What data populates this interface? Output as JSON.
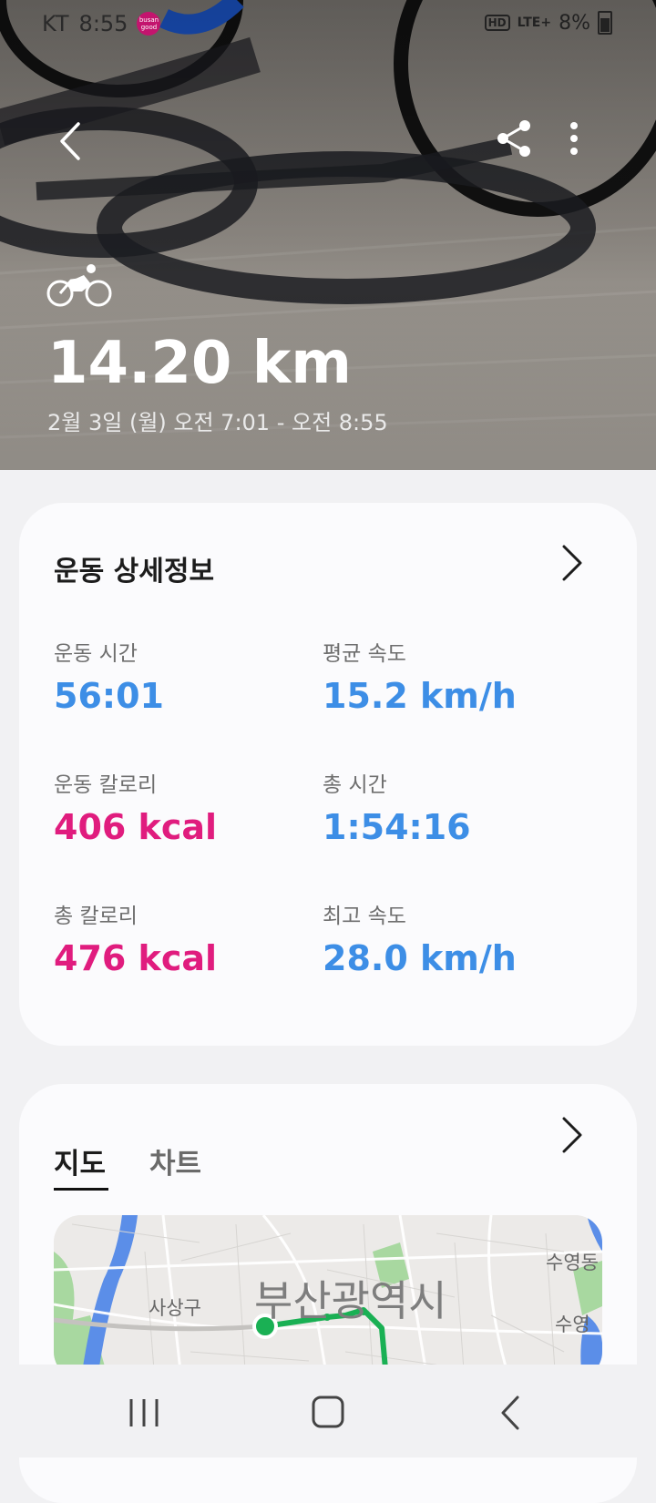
{
  "status_bar": {
    "carrier": "KT",
    "time": "8:55",
    "app_badge": "busan good",
    "hd": "HD",
    "network": "LTE+",
    "battery_text": "8%"
  },
  "hero": {
    "distance": "14.20 km",
    "date_range": "2월 3일 (월) 오전 7:01 - 오전 8:55"
  },
  "details": {
    "title": "운동 상세정보",
    "metrics": [
      {
        "label": "운동 시간",
        "value": "56:01",
        "color": "#3d8ee6"
      },
      {
        "label": "평균 속도",
        "value": "15.2 km/h",
        "color": "#3d8ee6"
      },
      {
        "label": "운동 칼로리",
        "value": "406 kcal",
        "color": "#e01c7e"
      },
      {
        "label": "총 시간",
        "value": "1:54:16",
        "color": "#3d8ee6"
      },
      {
        "label": "총 칼로리",
        "value": "476 kcal",
        "color": "#e01c7e"
      },
      {
        "label": "최고 속도",
        "value": "28.0 km/h",
        "color": "#3d8ee6"
      }
    ]
  },
  "map_section": {
    "tabs": [
      "지도",
      "차트"
    ],
    "map_labels": {
      "city": "부산광역시",
      "district": "사상구",
      "top_right": "수영동",
      "right": "수영"
    }
  }
}
